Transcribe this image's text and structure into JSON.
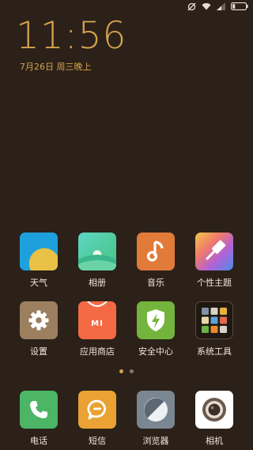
{
  "clock": {
    "time": "11:56",
    "date": "7月26日 周三晚上"
  },
  "status": {
    "icons": [
      "sync-off-icon",
      "wifi-icon",
      "signal-icon",
      "battery-icon"
    ]
  },
  "apps_row1": [
    {
      "label": "天气",
      "icon": "weather-icon"
    },
    {
      "label": "相册",
      "icon": "gallery-icon"
    },
    {
      "label": "音乐",
      "icon": "music-icon"
    },
    {
      "label": "个性主题",
      "icon": "themes-icon"
    }
  ],
  "apps_row2": [
    {
      "label": "设置",
      "icon": "gear-icon"
    },
    {
      "label": "应用商店",
      "icon": "store-icon",
      "logo": "MI"
    },
    {
      "label": "安全中心",
      "icon": "security-icon"
    },
    {
      "label": "系统工具",
      "icon": "tools-folder-icon"
    }
  ],
  "dock": [
    {
      "label": "电话",
      "icon": "phone-icon"
    },
    {
      "label": "短信",
      "icon": "messages-icon"
    },
    {
      "label": "浏览器",
      "icon": "browser-icon"
    },
    {
      "label": "相机",
      "icon": "camera-icon"
    }
  ],
  "pager": {
    "current": 1,
    "total": 2
  },
  "colors": {
    "background": "#2b2119",
    "accent": "#d7a24e",
    "weather": "#1ea0dc",
    "gallery": "#53d3a5",
    "music": "#e27a3a",
    "settings": "#9b7f5e",
    "store": "#f46a45",
    "security": "#72b43c",
    "phone": "#4cb566",
    "messages": "#e9a233",
    "browser": "#7a8691",
    "camera": "#ffffff"
  }
}
